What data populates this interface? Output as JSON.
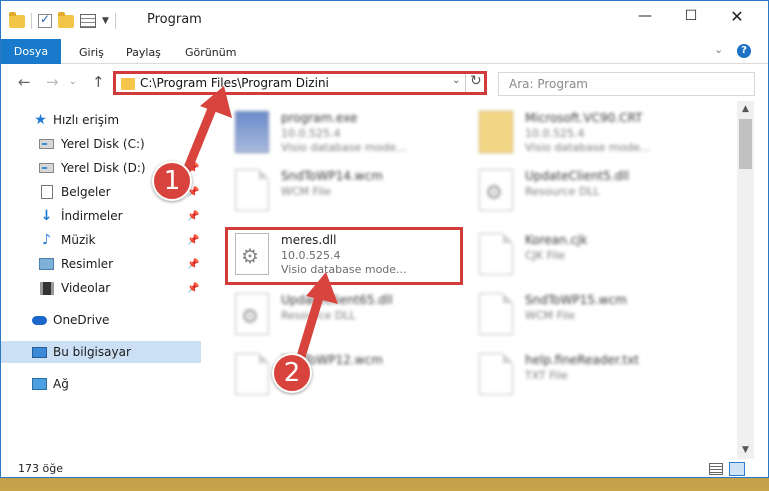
{
  "window": {
    "title": "Program"
  },
  "ribbon": {
    "tabs": [
      "Dosya",
      "Giriş",
      "Paylaş",
      "Görünüm"
    ]
  },
  "address": {
    "path": "C:\\Program Files\\Program Dizini",
    "search_placeholder": "Ara: Program"
  },
  "sidebar": {
    "items": [
      {
        "label": "Hızlı erişim",
        "icon": "star-icon"
      },
      {
        "label": "Yerel Disk (C:)",
        "icon": "drive-icon"
      },
      {
        "label": "Yerel Disk (D:)",
        "icon": "drive-icon"
      },
      {
        "label": "Belgeler",
        "icon": "documents-icon"
      },
      {
        "label": "İndirmeler",
        "icon": "download-icon"
      },
      {
        "label": "Müzik",
        "icon": "music-icon"
      },
      {
        "label": "Resimler",
        "icon": "pictures-icon"
      },
      {
        "label": "Videolar",
        "icon": "videos-icon"
      },
      {
        "label": "OneDrive",
        "icon": "cloud-icon"
      },
      {
        "label": "Bu bilgisayar",
        "icon": "computer-icon"
      },
      {
        "label": "Ağ",
        "icon": "network-icon"
      }
    ]
  },
  "files": [
    {
      "name": "program.exe",
      "line2": "10.0.525.4",
      "line3": "Visio database mode..."
    },
    {
      "name": "Microsoft.VC90.CRT",
      "line2": "10.0.525.4",
      "line3": "Visio database mode..."
    },
    {
      "name": "SndToWP14.wcm",
      "line2": "WCM File",
      "line3": ""
    },
    {
      "name": "UpdateClient5.dll",
      "line2": "Resource DLL",
      "line3": ""
    },
    {
      "name": "meres.dll",
      "line2": "10.0.525.4",
      "line3": "Visio database mode..."
    },
    {
      "name": "Korean.cjk",
      "line2": "CJK File",
      "line3": ""
    },
    {
      "name": "UpdateClient65.dll",
      "line2": "Resource DLL",
      "line3": ""
    },
    {
      "name": "SndToWP15.wcm",
      "line2": "WCM File",
      "line3": ""
    },
    {
      "name": "SndToWP12.wcm",
      "line2": "",
      "line3": ""
    },
    {
      "name": "help.fineReader.txt",
      "line2": "TXT File",
      "line3": ""
    }
  ],
  "status": {
    "count": "173 öğe"
  },
  "markers": [
    "1",
    "2"
  ],
  "colors": {
    "accent": "#1979ca",
    "highlight": "#d33a3a"
  }
}
